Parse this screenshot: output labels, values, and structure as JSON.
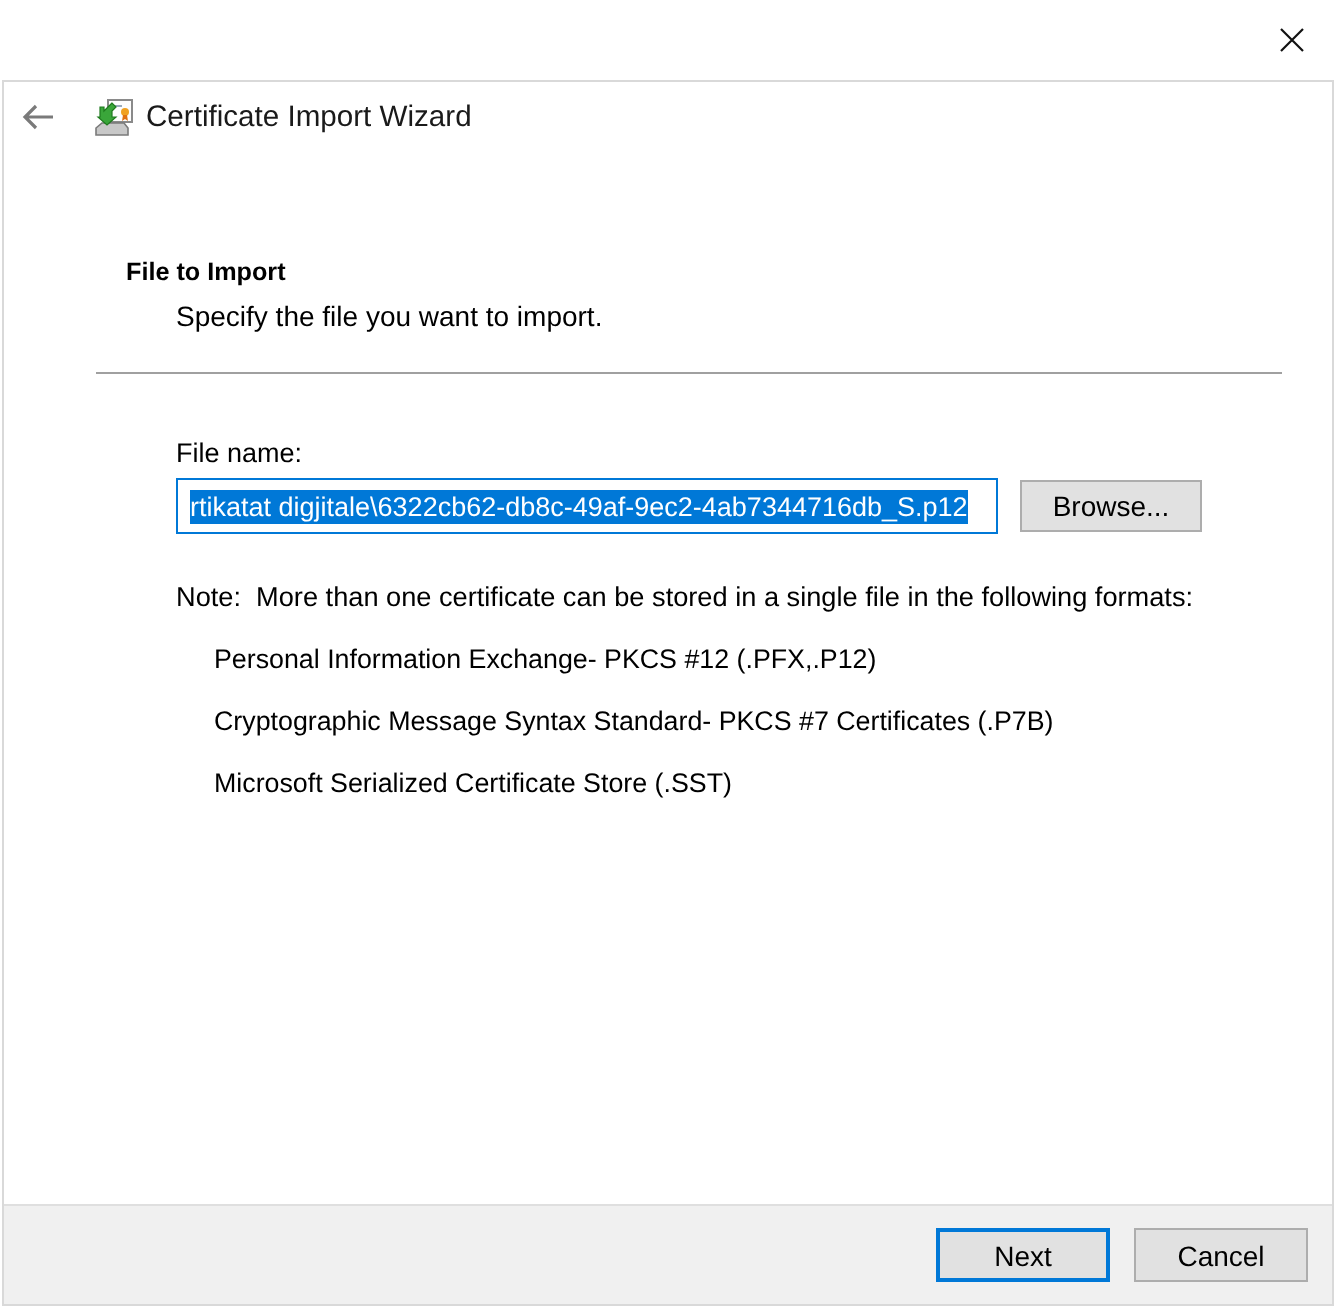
{
  "wizard": {
    "title": "Certificate Import Wizard"
  },
  "page": {
    "heading": "File to Import",
    "description": "Specify the file you want to import."
  },
  "file_name": {
    "label": "File name:",
    "value": "rtikatat digjitale\\6322cb62-db8c-49af-9ec2-4ab7344716db_S.p12",
    "focused": true,
    "text_selected": true
  },
  "browse_button": {
    "label": "Browse..."
  },
  "note": "Note:  More than one certificate can be stored in a single file in the following formats:",
  "formats": [
    "Personal Information Exchange- PKCS #12 (.PFX,.P12)",
    "Cryptographic Message Syntax Standard- PKCS #7 Certificates (.P7B)",
    "Microsoft Serialized Certificate Store (.SST)"
  ],
  "buttons": [
    {
      "label": "Next",
      "default": true
    },
    {
      "label": "Cancel",
      "default": false
    }
  ]
}
